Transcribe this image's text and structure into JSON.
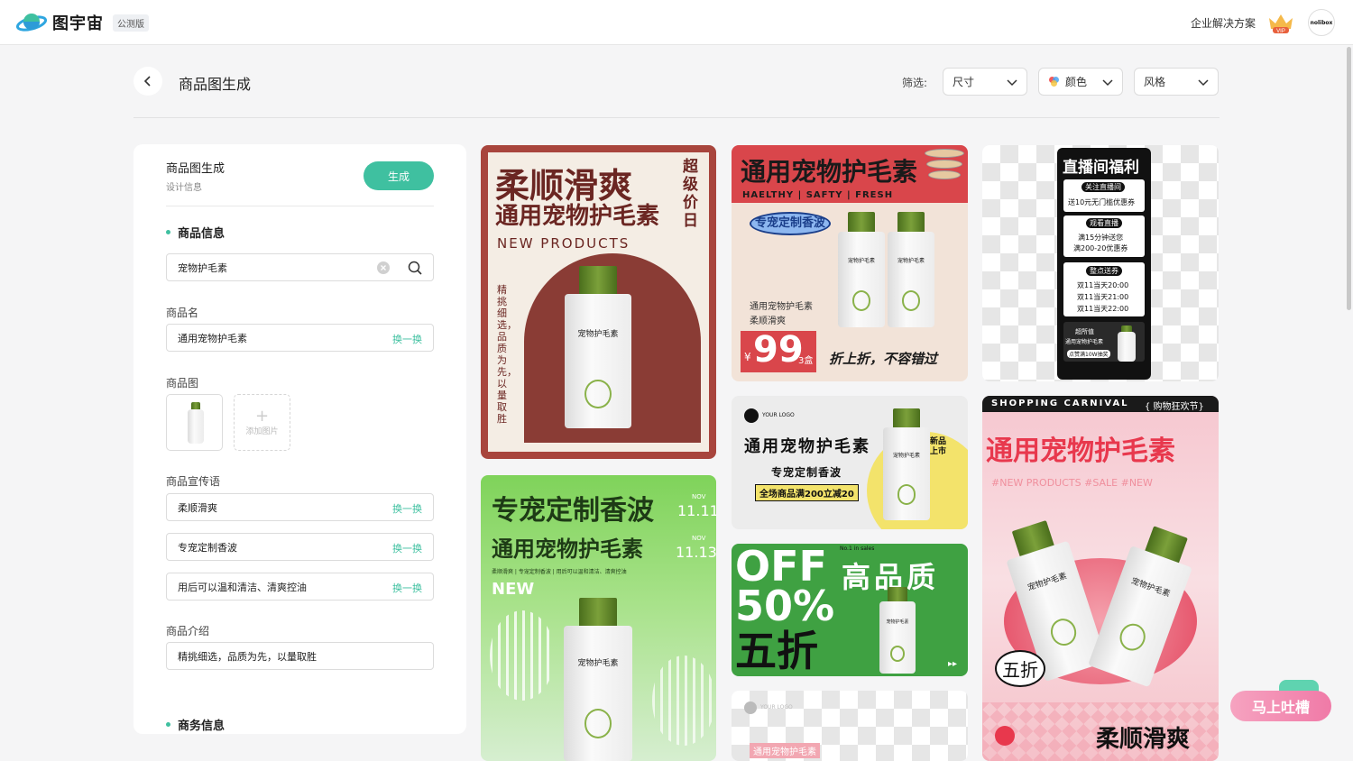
{
  "app": {
    "name": "图宇宙",
    "badge": "公测版",
    "enterprise": "企业解决方案",
    "vip_label": "VIP",
    "user": "nolibox"
  },
  "header": {
    "title": "商品图生成",
    "filter_label": "筛选:",
    "filters": [
      {
        "label": "尺寸"
      },
      {
        "label": "颜色"
      },
      {
        "label": "风格"
      }
    ]
  },
  "panel": {
    "title": "商品图生成",
    "subtitle": "设计信息",
    "generate": "生成",
    "section_product": "商品信息",
    "search_value": "宠物护毛素",
    "name_label": "商品名",
    "name_value": "通用宠物护毛素",
    "swap": "换一换",
    "image_label": "商品图",
    "add_image": "添加图片",
    "slogan_label": "商品宣传语",
    "slogans": [
      "柔顺滑爽",
      "专宠定制香波",
      "用后可以温和清洁、清爽控油"
    ],
    "intro_label": "商品介绍",
    "intro_value": "精挑细选，品质为先，以量取胜",
    "section_business": "商务信息"
  },
  "cards": {
    "c1": {
      "title1": "柔顺滑爽",
      "title2": "通用宠物护毛素",
      "sub": "NEW PRODUCTS",
      "side": "超级价日",
      "vertical": "精挑细选，品质为先，以量取胜",
      "bottle": "宠物护毛素"
    },
    "c2": {
      "title": "通用宠物护毛素",
      "tags": "HAELTHY | SAFTY | FRESH",
      "bubble": "专宠定制香波",
      "desc1": "通用宠物护毛素",
      "desc2": "柔顺滑爽",
      "price_sym": "¥",
      "price": "99",
      "unit": "3盒",
      "promo": "折上折，不容错过",
      "bottle": "宠物护毛素"
    },
    "c3": {
      "title": "直播间福利",
      "tag1": "关注直播间",
      "line1": "送10元无门槛优惠券",
      "tag2": "观看直播",
      "line2a": "满15分钟送您",
      "line2b": "满200-20优惠券",
      "tag3": "整点送券",
      "t1": "双11当天20:00",
      "t2": "双11当天21:00",
      "t3": "双11当天22:00",
      "foot1": "超所值",
      "foot2": "通用宠物护毛素",
      "foot3": "点赞满10W抽奖"
    },
    "c4": {
      "logo": "YOUR LOGO",
      "title": "通用宠物护毛素",
      "sub": "专宠定制香波",
      "promo": "全场商品满200立减20",
      "burst": "新品上市",
      "bottle": "宠物护毛素"
    },
    "c5": {
      "title1": "专宠定制香波",
      "title2": "通用宠物护毛素",
      "small": "柔顺滑爽 | 专宠定制香波 | 用后可以温和清洁、清爽控油",
      "new": "NEW",
      "m1": "NOV",
      "d1": "11.11",
      "m2": "NOV",
      "d2": "11.13",
      "bottle": "宠物护毛素"
    },
    "c6": {
      "sales": "No.1 in sales",
      "off": "OFF",
      "pct": "50%",
      "cn": "五折",
      "quality": "高品质",
      "bottle": "宠物护毛素"
    },
    "c7": {
      "tag": "SHOPPING CARNIVAL",
      "tag2": "{ 购物狂欢节}",
      "title": "通用宠物护毛素",
      "hashes": "#NEW PRODUCTS   #SALE   #NEW",
      "burst": "五折",
      "bottom": "柔顺滑爽",
      "bottle": "宠物护毛素"
    },
    "c8": {
      "logo": "YOUR LOGO",
      "title": "通用宠物护毛素"
    }
  },
  "feedback": "马上吐槽"
}
